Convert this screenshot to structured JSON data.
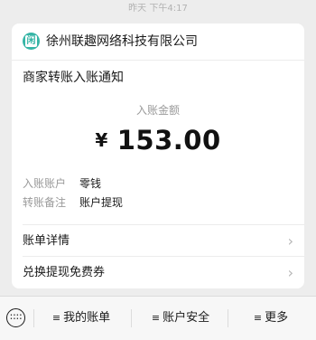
{
  "timestamp": "昨天 下午4:17",
  "merchant": {
    "logo_char": "闲",
    "name": "徐州联趣网络科技有限公司"
  },
  "notice": {
    "title": "商家转账入账通知",
    "amount_label": "入账金额",
    "currency_symbol": "¥",
    "amount": "153.00",
    "details": [
      {
        "key": "入账账户",
        "value": "零钱"
      },
      {
        "key": "转账备注",
        "value": "账户提现"
      }
    ]
  },
  "links": [
    {
      "label": "账单详情",
      "chevron": "›"
    },
    {
      "label": "兑换提现免费券",
      "chevron": "›"
    }
  ],
  "bottom_menu": {
    "keyboard_icon": "keyboard-icon",
    "items": [
      {
        "icon": "≡",
        "label": "我的账单"
      },
      {
        "icon": "≡",
        "label": "账户安全"
      },
      {
        "icon": "≡",
        "label": "更多"
      }
    ]
  },
  "colors": {
    "background": "#ededed",
    "card": "#ffffff",
    "logo_accent": "#36b5a6",
    "muted_text": "#9a9a9a"
  }
}
